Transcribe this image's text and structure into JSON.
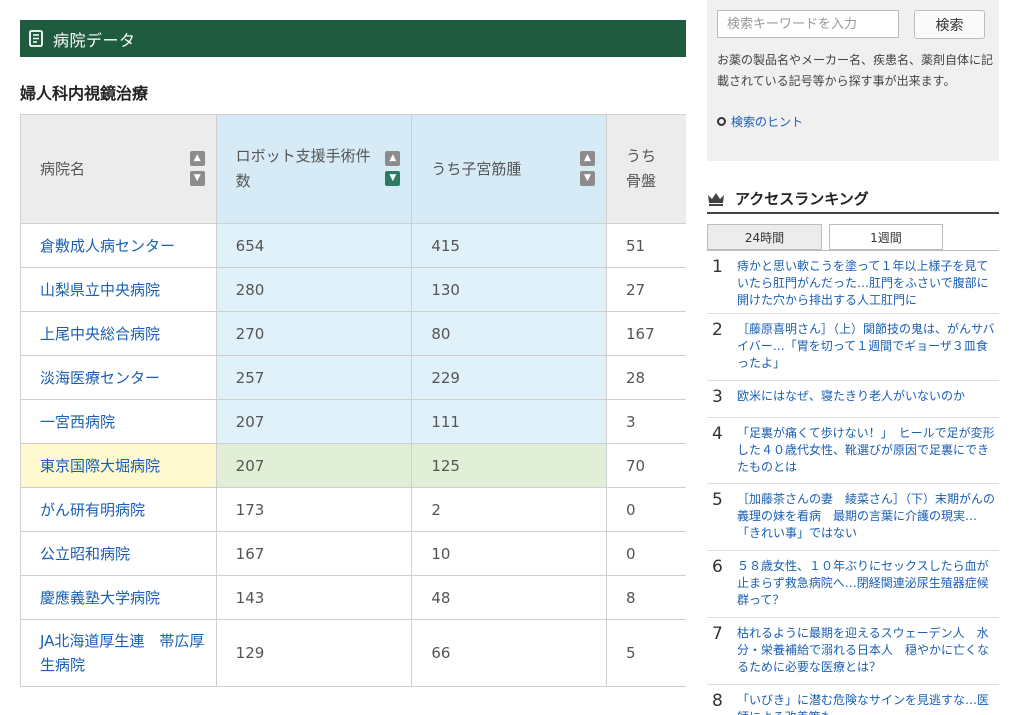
{
  "section": {
    "title": "病院データ"
  },
  "subtitle": "婦人科内視鏡治療",
  "table": {
    "headers": [
      "病院名",
      "ロボット支援手術件数",
      "うち子宮筋腫",
      "うち骨盤"
    ],
    "rows": [
      {
        "name": "倉敷成人病センター",
        "robot": "654",
        "myoma": "415",
        "pelvic": "51"
      },
      {
        "name": "山梨県立中央病院",
        "robot": "280",
        "myoma": "130",
        "pelvic": "27"
      },
      {
        "name": "上尾中央総合病院",
        "robot": "270",
        "myoma": "80",
        "pelvic": "167"
      },
      {
        "name": "淡海医療センター",
        "robot": "257",
        "myoma": "229",
        "pelvic": "28"
      },
      {
        "name": "一宮西病院",
        "robot": "207",
        "myoma": "111",
        "pelvic": "3"
      },
      {
        "name": "東京国際大堀病院",
        "robot": "207",
        "myoma": "125",
        "pelvic": "70"
      },
      {
        "name": "がん研有明病院",
        "robot": "173",
        "myoma": "2",
        "pelvic": "0"
      },
      {
        "name": "公立昭和病院",
        "robot": "167",
        "myoma": "10",
        "pelvic": "0"
      },
      {
        "name": "慶應義塾大学病院",
        "robot": "143",
        "myoma": "48",
        "pelvic": "8"
      },
      {
        "name": "JA北海道厚生連　帯広厚生病院",
        "robot": "129",
        "myoma": "66",
        "pelvic": "5"
      }
    ]
  },
  "search": {
    "placeholder": "検索キーワードを入力",
    "button": "検索",
    "help": "お薬の製品名やメーカー名、疾患名、薬剤自体に記載されている記号等から探す事が出来ます。",
    "hint": "検索のヒント"
  },
  "ranking": {
    "title": "アクセスランキング",
    "tabs": [
      "24時間",
      "1週間"
    ],
    "items": [
      {
        "rank": "1",
        "title": "痔かと思い軟こうを塗って１年以上様子を見ていたら肛門がんだった…肛門をふさいで腹部に開けた穴から排出する人工肛門に"
      },
      {
        "rank": "2",
        "title": "［藤原喜明さん］（上）関節技の鬼は、がんサバイバー…「胃を切って１週間でギョーザ３皿食ったよ」"
      },
      {
        "rank": "3",
        "title": "欧米にはなぜ、寝たきり老人がいないのか"
      },
      {
        "rank": "4",
        "title": "「足裏が痛くて歩けない！」　ヒールで足が変形した４０歳代女性、靴選びが原因で足裏にできたものとは"
      },
      {
        "rank": "5",
        "title": "［加藤茶さんの妻　綾菜さん］（下）末期がんの義理の妹を看病　最期の言葉に介護の現実…「きれい事」ではない"
      },
      {
        "rank": "6",
        "title": "５８歳女性、１０年ぶりにセックスしたら血が止まらず救急病院へ…閉経関連泌尿生殖器症候群って？"
      },
      {
        "rank": "7",
        "title": "枯れるように最期を迎えるスウェーデン人　水分・栄養補給で溺れる日本人　穏やかに亡くなるために必要な医療とは？"
      },
      {
        "rank": "8",
        "title": "「いびき」に潜む危険なサインを見逃すな…医師による改善策も"
      }
    ]
  }
}
